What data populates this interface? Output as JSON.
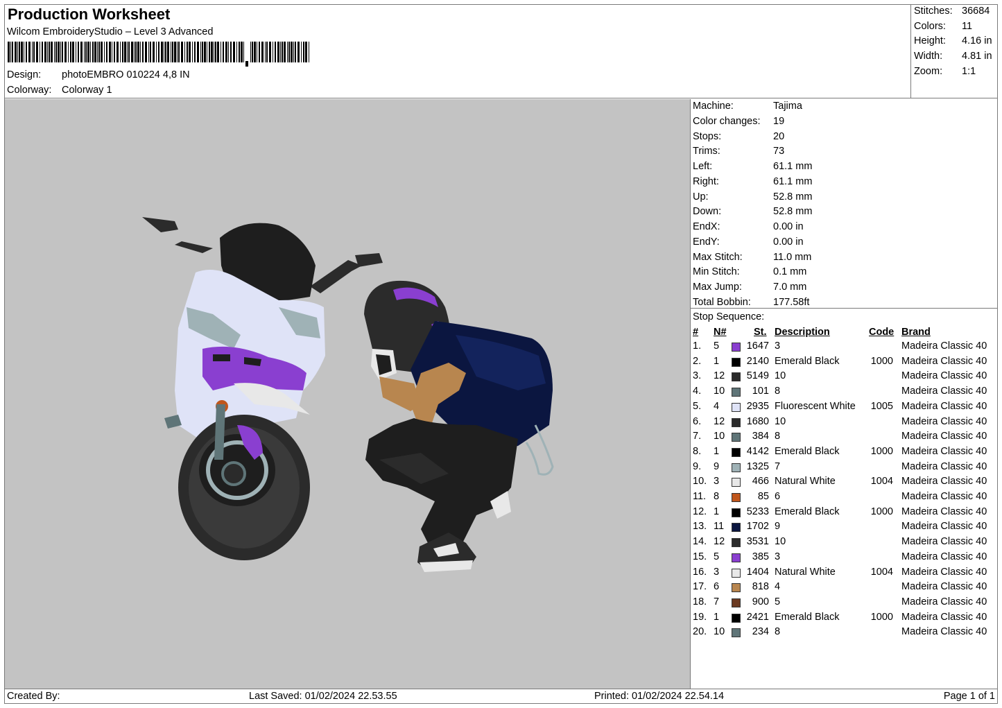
{
  "header": {
    "title": "Production Worksheet",
    "software": "Wilcom EmbroideryStudio – Level 3 Advanced",
    "design_label": "Design:",
    "design_value": "photoEMBRO 010224 4,8 IN",
    "colorway_label": "Colorway:",
    "colorway_value": "Colorway 1"
  },
  "summary": {
    "stitches_label": "Stitches:",
    "stitches": "36684",
    "colors_label": "Colors:",
    "colors": "11",
    "height_label": "Height:",
    "height": "4.16 in",
    "width_label": "Width:",
    "width": "4.81 in",
    "zoom_label": "Zoom:",
    "zoom": "1:1"
  },
  "machine_info": [
    {
      "label": "Machine:",
      "value": "Tajima"
    },
    {
      "label": "Color changes:",
      "value": "19"
    },
    {
      "label": "Stops:",
      "value": "20"
    },
    {
      "label": "Trims:",
      "value": "73"
    },
    {
      "label": "Left:",
      "value": "61.1 mm"
    },
    {
      "label": "Right:",
      "value": "61.1 mm"
    },
    {
      "label": "Up:",
      "value": "52.8 mm"
    },
    {
      "label": "Down:",
      "value": "52.8 mm"
    },
    {
      "label": "EndX:",
      "value": "0.00 in"
    },
    {
      "label": "EndY:",
      "value": "0.00 in"
    },
    {
      "label": "Max Stitch:",
      "value": "11.0 mm"
    },
    {
      "label": "Min Stitch:",
      "value": "0.1 mm"
    },
    {
      "label": "Max Jump:",
      "value": "7.0 mm"
    },
    {
      "label": "Total Bobbin:",
      "value": "177.58ft"
    }
  ],
  "stop_sequence": {
    "title": "Stop Sequence:",
    "headers": {
      "num": "#",
      "n": "N#",
      "st": "St.",
      "desc": "Description",
      "code": "Code",
      "brand": "Brand"
    },
    "rows": [
      {
        "num": "1.",
        "n": "5",
        "color": "#8a3fd0",
        "st": "1647",
        "desc": "3",
        "code": "",
        "brand": "Madeira Classic 40"
      },
      {
        "num": "2.",
        "n": "1",
        "color": "#000000",
        "st": "2140",
        "desc": "Emerald Black",
        "code": "1000",
        "brand": "Madeira Classic 40"
      },
      {
        "num": "3.",
        "n": "12",
        "color": "#2b2b2b",
        "st": "5149",
        "desc": "10",
        "code": "",
        "brand": "Madeira Classic 40"
      },
      {
        "num": "4.",
        "n": "10",
        "color": "#5f7578",
        "st": "101",
        "desc": "8",
        "code": "",
        "brand": "Madeira Classic 40"
      },
      {
        "num": "5.",
        "n": "4",
        "color": "#dfe3f7",
        "st": "2935",
        "desc": "Fluorescent White",
        "code": "1005",
        "brand": "Madeira Classic 40"
      },
      {
        "num": "6.",
        "n": "12",
        "color": "#2b2b2b",
        "st": "1680",
        "desc": "10",
        "code": "",
        "brand": "Madeira Classic 40"
      },
      {
        "num": "7.",
        "n": "10",
        "color": "#5f7578",
        "st": "384",
        "desc": "8",
        "code": "",
        "brand": "Madeira Classic 40"
      },
      {
        "num": "8.",
        "n": "1",
        "color": "#000000",
        "st": "4142",
        "desc": "Emerald Black",
        "code": "1000",
        "brand": "Madeira Classic 40"
      },
      {
        "num": "9.",
        "n": "9",
        "color": "#9fb2b6",
        "st": "1325",
        "desc": "7",
        "code": "",
        "brand": "Madeira Classic 40"
      },
      {
        "num": "10.",
        "n": "3",
        "color": "#e8e8e8",
        "st": "466",
        "desc": "Natural White",
        "code": "1004",
        "brand": "Madeira Classic 40"
      },
      {
        "num": "11.",
        "n": "8",
        "color": "#c0561c",
        "st": "85",
        "desc": "6",
        "code": "",
        "brand": "Madeira Classic 40"
      },
      {
        "num": "12.",
        "n": "1",
        "color": "#000000",
        "st": "5233",
        "desc": "Emerald Black",
        "code": "1000",
        "brand": "Madeira Classic 40"
      },
      {
        "num": "13.",
        "n": "11",
        "color": "#0b1640",
        "st": "1702",
        "desc": "9",
        "code": "",
        "brand": "Madeira Classic 40"
      },
      {
        "num": "14.",
        "n": "12",
        "color": "#2b2b2b",
        "st": "3531",
        "desc": "10",
        "code": "",
        "brand": "Madeira Classic 40"
      },
      {
        "num": "15.",
        "n": "5",
        "color": "#8a3fd0",
        "st": "385",
        "desc": "3",
        "code": "",
        "brand": "Madeira Classic 40"
      },
      {
        "num": "16.",
        "n": "3",
        "color": "#e8e8e8",
        "st": "1404",
        "desc": "Natural White",
        "code": "1004",
        "brand": "Madeira Classic 40"
      },
      {
        "num": "17.",
        "n": "6",
        "color": "#b8864f",
        "st": "818",
        "desc": "4",
        "code": "",
        "brand": "Madeira Classic 40"
      },
      {
        "num": "18.",
        "n": "7",
        "color": "#6b3a22",
        "st": "900",
        "desc": "5",
        "code": "",
        "brand": "Madeira Classic 40"
      },
      {
        "num": "19.",
        "n": "1",
        "color": "#000000",
        "st": "2421",
        "desc": "Emerald Black",
        "code": "1000",
        "brand": "Madeira Classic 40"
      },
      {
        "num": "20.",
        "n": "10",
        "color": "#5f7578",
        "st": "234",
        "desc": "8",
        "code": "",
        "brand": "Madeira Classic 40"
      }
    ]
  },
  "footer": {
    "created_by": "Created By:",
    "last_saved": "Last Saved: 01/02/2024 22.53.55",
    "printed": "Printed: 01/02/2024 22.54.14",
    "page": "Page 1 of 1"
  },
  "preview": {
    "background": "#c3c3c3",
    "description_icon": "embroidery-design-preview"
  }
}
